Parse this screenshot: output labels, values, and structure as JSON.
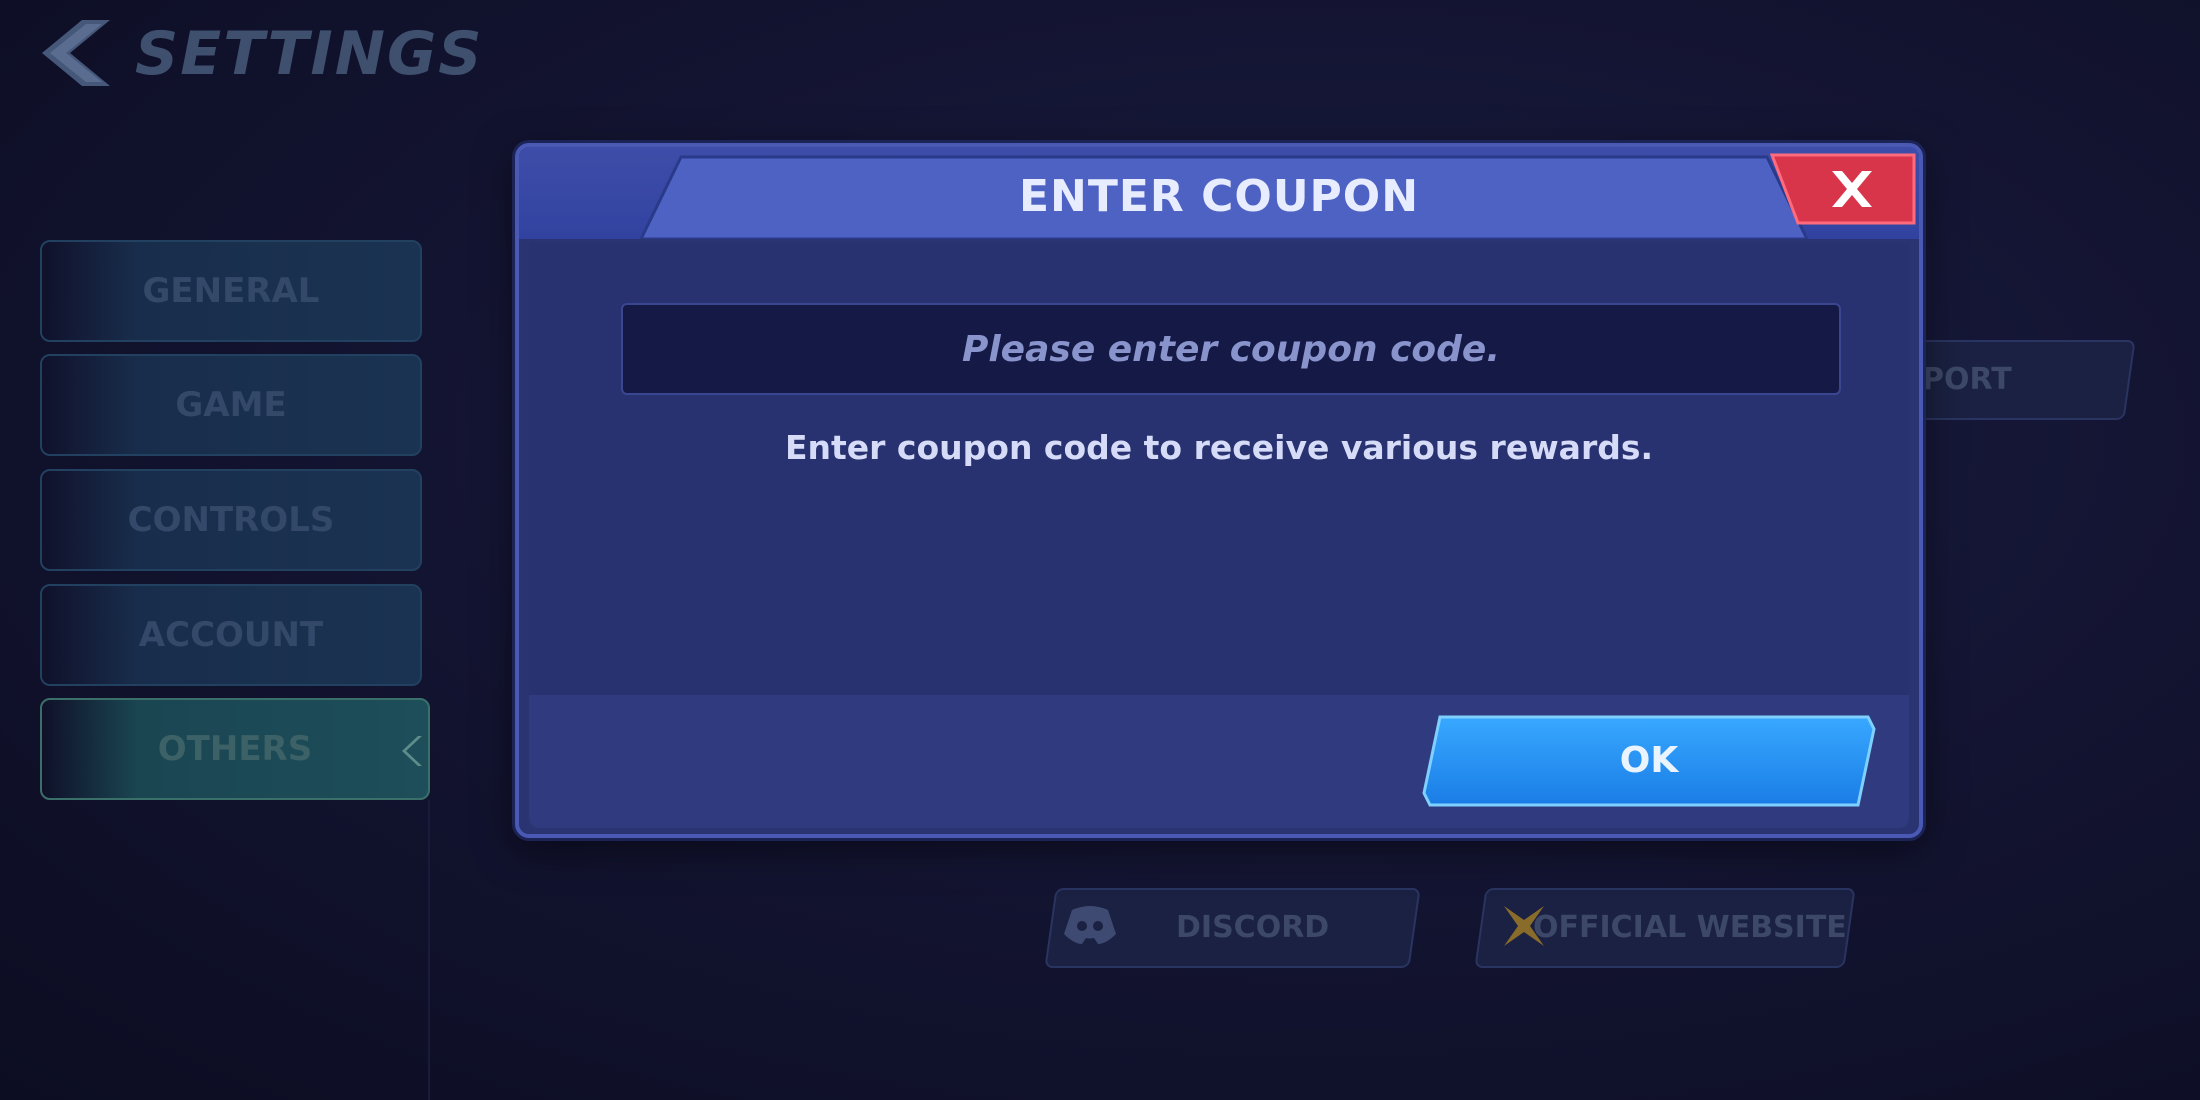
{
  "header": {
    "title": "SETTINGS"
  },
  "sidebar": {
    "items": [
      {
        "label": "GENERAL"
      },
      {
        "label": "GAME"
      },
      {
        "label": "CONTROLS"
      },
      {
        "label": "ACCOUNT"
      },
      {
        "label": "OTHERS",
        "active": true
      }
    ]
  },
  "background_buttons": {
    "support_partial": "PORT",
    "discord": "DISCORD",
    "official_website": "OFFICIAL WEBSITE"
  },
  "modal": {
    "title": "ENTER COUPON",
    "input_placeholder": "Please enter coupon code.",
    "input_value": "",
    "hint": "Enter coupon code to receive various rewards.",
    "ok_label": "OK"
  },
  "colors": {
    "modal_bg": "#2a3472",
    "modal_header": "#3d4da8",
    "close_red": "#d8344a",
    "ok_blue": "#1e8cf0"
  },
  "icons": [
    "back-chevron-icon",
    "close-icon",
    "discord-icon",
    "star-icon",
    "active-indicator-icon"
  ]
}
